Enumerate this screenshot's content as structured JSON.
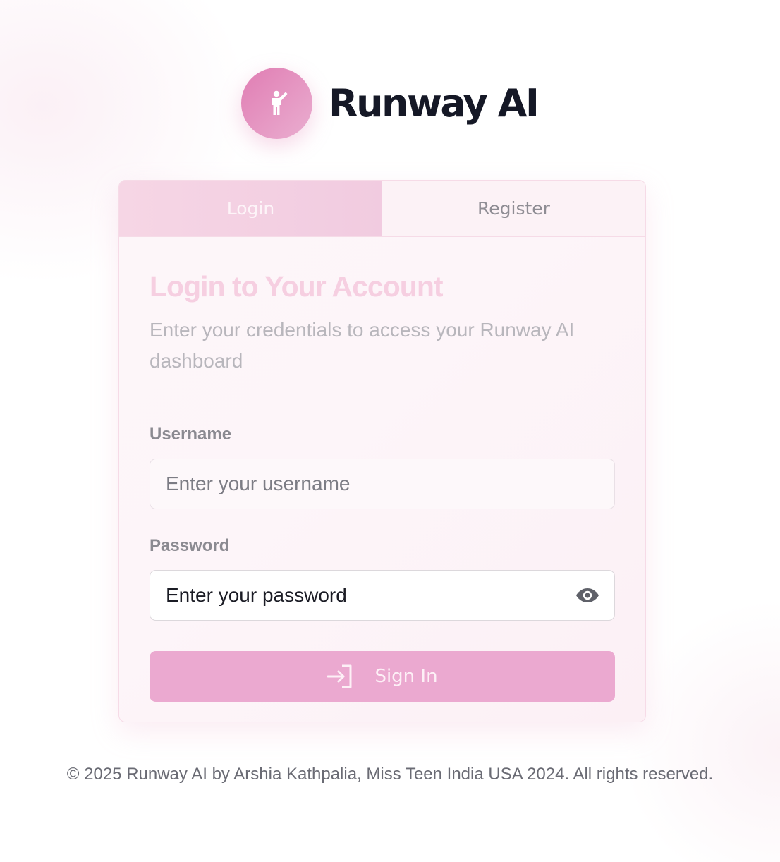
{
  "brand": {
    "name": "Runway AI",
    "logo_icon": "person-waving-icon",
    "accent_color": "#e07db3"
  },
  "tabs": [
    {
      "label": "Login",
      "active": true
    },
    {
      "label": "Register",
      "active": false
    }
  ],
  "form": {
    "heading": "Login to Your Account",
    "subtext": "Enter your credentials to access your Runway AI dashboard",
    "username": {
      "label": "Username",
      "placeholder": "Enter your username",
      "value": ""
    },
    "password": {
      "label": "Password",
      "placeholder": "Enter your password",
      "value": "",
      "toggle_icon": "eye-icon"
    },
    "submit": {
      "label": "Sign In",
      "icon": "sign-in-icon",
      "color": "#eba9d0"
    }
  },
  "footer": {
    "text": "© 2025 Runway AI by Arshia Kathpalia, Miss Teen India USA 2024. All rights reserved."
  }
}
